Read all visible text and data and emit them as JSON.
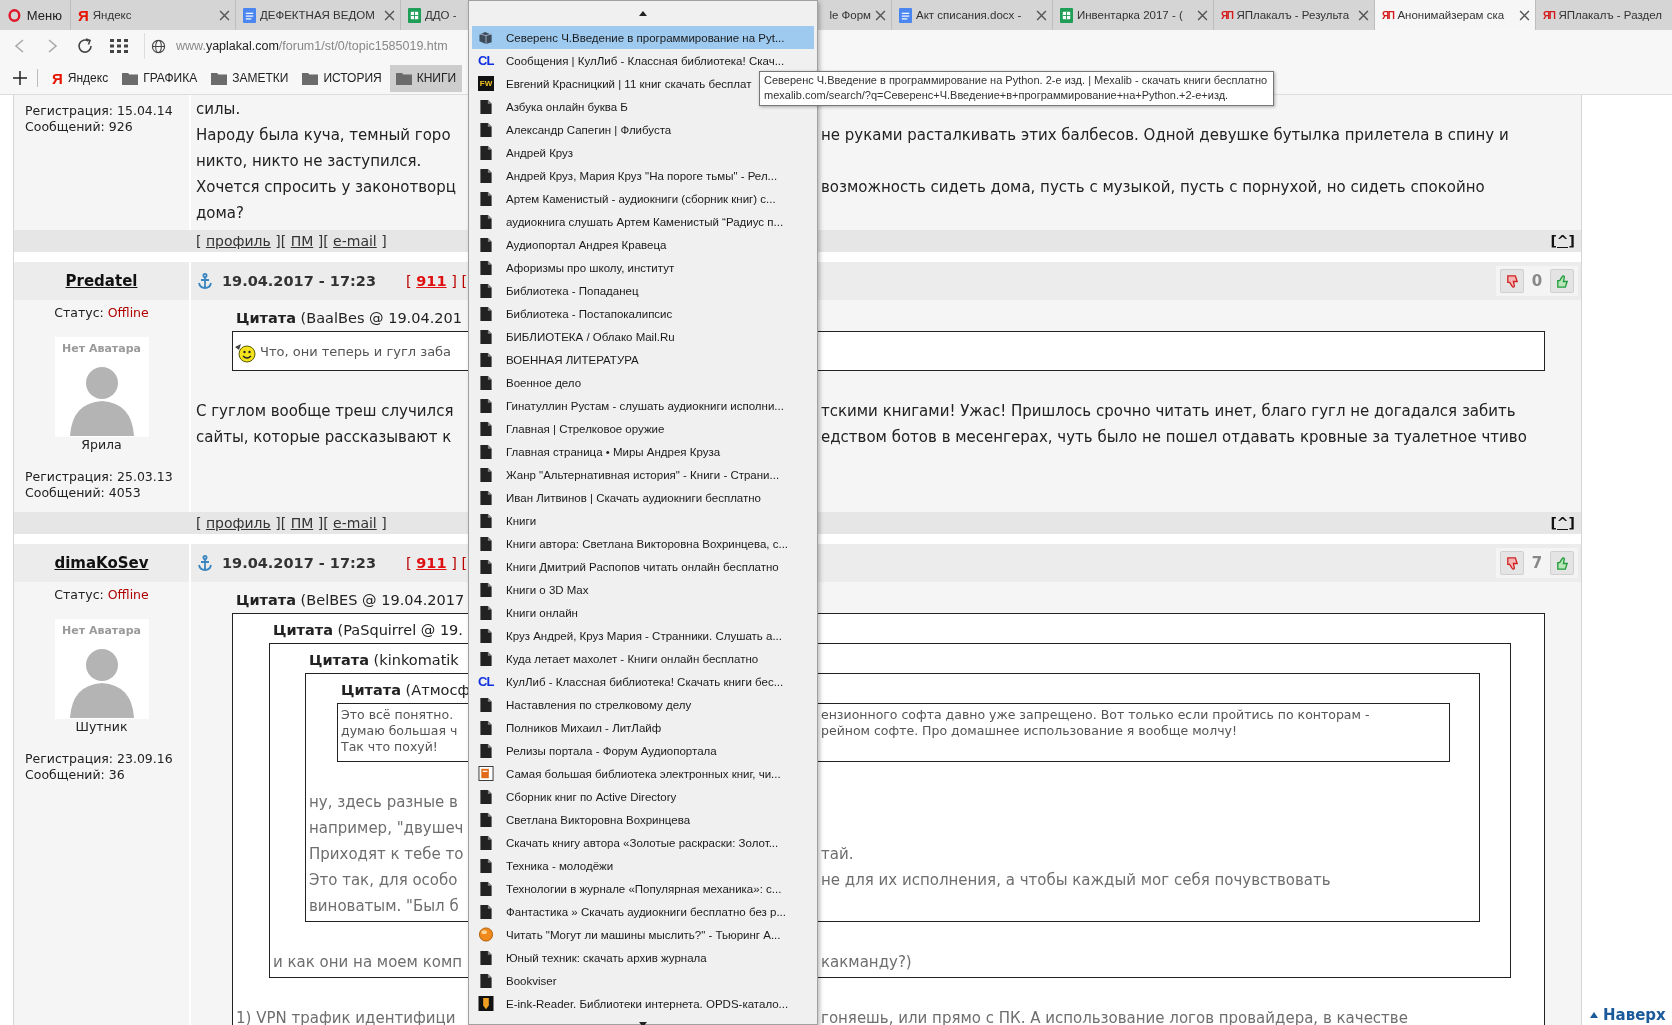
{
  "browser": {
    "menu": "Меню",
    "tabs": [
      {
        "title": "Яндекс",
        "kind": "yandex",
        "icon_text": "Я",
        "selected": false
      },
      {
        "title": "ДЕФЕКТНАЯ ВЕДОМ",
        "kind": "docs",
        "selected": false
      },
      {
        "title": "ДДО -",
        "kind": "sheets",
        "selected": false
      },
      {
        "title": "le Форм",
        "kind": "clipped",
        "selected": false
      },
      {
        "title": "Акт списания.docx -",
        "kind": "docs",
        "selected": false
      },
      {
        "title": "Инвентарка 2017 - (",
        "kind": "sheets",
        "selected": false
      },
      {
        "title": "ЯПлакалъ - Результа",
        "kind": "yap",
        "icon_text": "ЯП",
        "selected": false
      },
      {
        "title": "Анонимайзерам ска",
        "kind": "yap",
        "icon_text": "ЯП",
        "selected": true
      },
      {
        "title": "ЯПлакалъ - Раздел",
        "kind": "yap",
        "icon_text": "ЯП",
        "selected": false
      }
    ],
    "address": {
      "prefix": "www.",
      "host": "yaplakal.com",
      "path": "/forum1/st/0/topic1585019.htm"
    },
    "bookmarks": [
      {
        "label": "Яндекс",
        "kind": "site",
        "icon_text": "Я",
        "selected": false
      },
      {
        "label": "ГРАФИКА",
        "kind": "folder",
        "selected": false
      },
      {
        "label": "ЗАМЕТКИ",
        "kind": "folder",
        "selected": false
      },
      {
        "label": "ИСТОРИЯ",
        "kind": "folder",
        "selected": false
      },
      {
        "label": "КНИГИ",
        "kind": "folder",
        "selected": true
      }
    ]
  },
  "forum": {
    "posts": [
      {
        "kind": "tail",
        "registration": "Регистрация: 15.04.14",
        "messages": "Сообщений: 926",
        "body": [
          {
            "kind": "line",
            "left": "силы."
          },
          {
            "kind": "line",
            "left": "Народу была куча, темный горо",
            "right": "не руками расталкивать этих балбесов. Одной девушке бутылка прилетела в спину и"
          },
          {
            "kind": "line",
            "left": "никто, никто не заступился."
          },
          {
            "kind": "line",
            "left": "Хочется спросить у законотворц",
            "right": "возможность сидеть дома, пусть с музыкой, пусть с порнухой, но сидеть спокойно"
          },
          {
            "kind": "line",
            "left": "дома?"
          }
        ],
        "footer": {
          "open": "[",
          "close": "]",
          "links": [
            "профиль",
            "ПМ",
            "e-mail"
          ],
          "top_link": "[^]"
        }
      },
      {
        "kind": "full",
        "author": "Predatel",
        "date": "19.04.2017 - 17:23",
        "reply": {
          "open": "[",
          "number": "911",
          "close": "]",
          "next": "["
        },
        "votes": "0",
        "status_label": "Статус:",
        "status": "Offline",
        "avatar_caption": "Нет Аватара",
        "rank": "Ярила",
        "registration": "Регистрация: 25.03.13",
        "messages": "Сообщений: 4053",
        "body": [
          {
            "kind": "quote",
            "title": "**Цитата** (BaalBes @ 19.04.201",
            "children": [
              {
                "kind": "smiley",
                "text": "Что, они теперь и гугл заба"
              }
            ]
          },
          {
            "kind": "line",
            "left": "С гуглом вообще треш случился",
            "right": "тскими книгами! Ужас! Пришлось срочно читать инет, благо гугл не догадался забить"
          },
          {
            "kind": "line",
            "left": "сайты, которые рассказывают к",
            "right": "едством ботов в месенгерах, чуть было не пошел отдавать кровные за туалетное чтиво"
          }
        ],
        "footer": {
          "open": "[",
          "close": "]",
          "links": [
            "профиль",
            "ПМ",
            "e-mail"
          ],
          "top_link": "[^]"
        }
      },
      {
        "kind": "full",
        "author": "dimaKoSev",
        "date": "19.04.2017 - 17:23",
        "reply": {
          "open": "[",
          "number": "911",
          "close": "]",
          "next": "["
        },
        "votes": "7",
        "status_label": "Статус:",
        "status": "Offline",
        "avatar_caption": "Нет Аватара",
        "rank": "Шутник",
        "registration": "Регистрация: 23.09.16",
        "messages": "Сообщений: 36",
        "body": [
          {
            "kind": "quote",
            "title": "**Цитата** (BelBES @ 19.04.2017",
            "children": [
              {
                "kind": "quote",
                "title": "**Цитата** (PaSquirrel @ 19.",
                "children": [
                  {
                    "kind": "quote",
                    "title": "**Цитата** (kinkomatik",
                    "children": [
                      {
                        "kind": "quote",
                        "title": "**Цитата** (Атмосф",
                        "children": [
                          {
                            "kind": "small_line",
                            "left": "Это всё понятно.",
                            "right": "ензионного софта давно уже запрещено. Вот только если пройтись по конторам -"
                          },
                          {
                            "kind": "small_line",
                            "left": "думаю большая ч",
                            "right": "рейном софте. Про домашнее использование я вообще молчу!"
                          },
                          {
                            "kind": "small_line",
                            "left": "Так что похуй!"
                          }
                        ]
                      },
                      {
                        "kind": "muted_line",
                        "left": "ну, здесь разные в"
                      },
                      {
                        "kind": "muted_line",
                        "left": "например, \"двушеч"
                      },
                      {
                        "kind": "muted_line",
                        "left": "Приходят к тебе то",
                        "right": "тай."
                      },
                      {
                        "kind": "muted_line",
                        "left": "Это так, для особо",
                        "right": "не для их исполнения, а чтобы каждый мог себя почувствовать"
                      },
                      {
                        "kind": "muted_line",
                        "left": "виноватым. \"Был б"
                      }
                    ]
                  },
                  {
                    "kind": "muted_line",
                    "left": "и как они на моем комп",
                    "right": "какманду?)"
                  }
                ]
              },
              {
                "kind": "muted_line",
                "left": "1) VPN трафик идентифици",
                "right": "гоняешь, или прямо с ПК. А использование логов провайдера, в качестве"
              }
            ]
          }
        ]
      }
    ],
    "top_link": "Наверх"
  },
  "dropdown": {
    "items": [
      {
        "title": "Северенс Ч.Введение в программирование на Pyt...",
        "kind": "books",
        "selected": true
      },
      {
        "title": "Сообщения | КулЛиб - Классная библиотека! Скач...",
        "kind": "cl",
        "icon_text": "CL",
        "selected": false
      },
      {
        "title": "Евгений Красницкий | 11 книг скачать бесплат",
        "kind": "fw",
        "icon_text": "FW",
        "selected": false
      },
      {
        "title": "Азбука онлайн буква Б",
        "kind": "page",
        "selected": false
      },
      {
        "title": "Александр Сапегин | Флибуста",
        "kind": "page",
        "selected": false
      },
      {
        "title": "Андрей Круз",
        "kind": "page",
        "selected": false
      },
      {
        "title": "Андрей Круз, Мария Круз \"На пороге тьмы\" - Рел...",
        "kind": "page",
        "selected": false
      },
      {
        "title": "Артем Каменистый - аудиокниги (сборник книг) с...",
        "kind": "page",
        "selected": false
      },
      {
        "title": "аудиокнига слушать Артем Каменистый “Радиус п...",
        "kind": "page",
        "selected": false
      },
      {
        "title": "Аудиопортал Андрея Кравеца",
        "kind": "page",
        "selected": false
      },
      {
        "title": "Афоризмы про школу, институт",
        "kind": "page",
        "selected": false
      },
      {
        "title": "Библиотека - Попаданец",
        "kind": "page",
        "selected": false
      },
      {
        "title": "Библиотека - Постапокалипсис",
        "kind": "page",
        "selected": false
      },
      {
        "title": "БИБЛИОТЕКА / Облако Mail.Ru",
        "kind": "page",
        "selected": false
      },
      {
        "title": "ВОЕННАЯ ЛИТЕРАТУРА",
        "kind": "page",
        "selected": false
      },
      {
        "title": "Военное дело",
        "kind": "page",
        "selected": false
      },
      {
        "title": "Гинатуллин Рустам - слушать аудиокниги исполни...",
        "kind": "page",
        "selected": false
      },
      {
        "title": "Главная | Стрелковое оружие",
        "kind": "page",
        "selected": false
      },
      {
        "title": "Главная страница • Миры Андрея Круза",
        "kind": "page",
        "selected": false
      },
      {
        "title": "Жанр \"Альтернативная история\" - Книги - Страни...",
        "kind": "page",
        "selected": false
      },
      {
        "title": "Иван Литвинов | Скачать аудиокниги бесплатно",
        "kind": "page",
        "selected": false
      },
      {
        "title": "Книги",
        "kind": "page",
        "selected": false
      },
      {
        "title": "Книги автора: Светлана Викторовна Вохринцева, с...",
        "kind": "page",
        "selected": false
      },
      {
        "title": "Книги Дмитрий Распопов читать онлайн бесплатно",
        "kind": "page",
        "selected": false
      },
      {
        "title": "Книги о 3D Max",
        "kind": "page",
        "selected": false
      },
      {
        "title": "Книги онлайн",
        "kind": "page",
        "selected": false
      },
      {
        "title": "Круз Андрей, Круз Мария - Странники. Слушать а...",
        "kind": "page",
        "selected": false
      },
      {
        "title": "Куда летает махолет - Книги онлайн бесплатно",
        "kind": "page",
        "selected": false
      },
      {
        "title": "КулЛиб - Классная библиотека! Скачать книги бес...",
        "kind": "cl",
        "icon_text": "CL",
        "selected": false
      },
      {
        "title": "Наставления по стрелковому делу",
        "kind": "page",
        "selected": false
      },
      {
        "title": "Полников Михаил - ЛитЛайф",
        "kind": "page",
        "selected": false
      },
      {
        "title": "Релизы портала - Форум Аудиопортала",
        "kind": "page",
        "selected": false
      },
      {
        "title": "Самая большая библиотека электронных книг, чи...",
        "kind": "ebook",
        "selected": false
      },
      {
        "title": "Сборник книг по Active Directory",
        "kind": "page",
        "selected": false
      },
      {
        "title": "Светлана Викторовна Вохринцева",
        "kind": "page",
        "selected": false
      },
      {
        "title": "Скачать книгу автора «Золотые раскраски: Золот...",
        "kind": "page",
        "selected": false
      },
      {
        "title": "Техника - молодёжи",
        "kind": "page",
        "selected": false
      },
      {
        "title": "Технологии в журнале «Популярная механика»: с...",
        "kind": "page",
        "selected": false
      },
      {
        "title": "Фантастика » Скачать аудиокниги бесплатно без р...",
        "kind": "page",
        "selected": false
      },
      {
        "title": "Читать \"Могут ли машины мыслить?\" - Тьюринг А...",
        "kind": "orb",
        "selected": false
      },
      {
        "title": "Юный техник: скачать архив журнала",
        "kind": "page",
        "selected": false
      },
      {
        "title": "Bookviser",
        "kind": "page",
        "selected": false
      },
      {
        "title": "E-ink-Reader. Библиотеки интернета. OPDS-катало...",
        "kind": "reader",
        "selected": false
      }
    ]
  },
  "tooltip": {
    "title": "Северенс Ч.Введение в программирование на Python. 2-е изд. | Mexalib - скачать книги бесплатно",
    "url": "mexalib.com/search/?q=Северенс+Ч.Введение+в+программирование+на+Python.+2-е+изд."
  }
}
